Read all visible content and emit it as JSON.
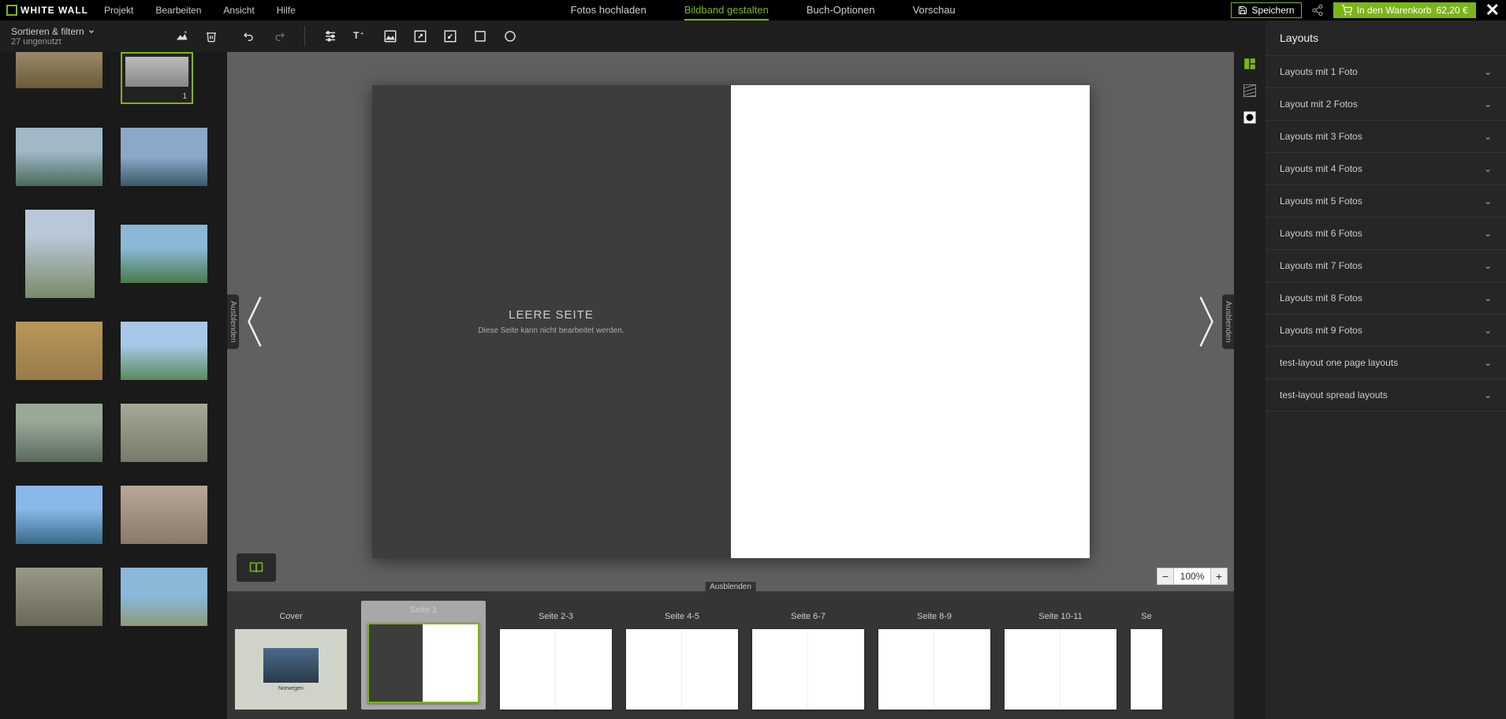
{
  "brand": "WHITE WALL",
  "top_menu": {
    "project": "Projekt",
    "edit": "Bearbeiten",
    "view": "Ansicht",
    "help": "Hilfe"
  },
  "nav": {
    "upload": "Fotos hochladen",
    "design": "Bildband gestalten",
    "options": "Buch-Optionen",
    "preview": "Vorschau"
  },
  "actions": {
    "save": "Speichern",
    "cart": "In den Warenkorb",
    "price": "62,20 €"
  },
  "sort": {
    "label": "Sortieren & filtern",
    "sub": "27 ungenutzt"
  },
  "page": {
    "title": "LEERE SEITE",
    "subtitle": "Diese Seite kann nicht bearbeitet werden."
  },
  "zoom": "100%",
  "hide_label": "Ausblenden",
  "tooltip": "Ausblenden",
  "selected_thumb_badge": "1",
  "filmstrip": [
    {
      "label": "Cover",
      "type": "cover",
      "cover_text": "Norwegen"
    },
    {
      "label": "Seite 1",
      "type": "selected"
    },
    {
      "label": "Seite 2-3",
      "type": "spread"
    },
    {
      "label": "Seite 4-5",
      "type": "spread"
    },
    {
      "label": "Seite 6-7",
      "type": "spread"
    },
    {
      "label": "Seite 8-9",
      "type": "spread"
    },
    {
      "label": "Seite 10-11",
      "type": "spread"
    },
    {
      "label": "Se",
      "type": "spread"
    }
  ],
  "right_panel": {
    "title": "Layouts",
    "items": [
      "Layouts mit 1 Foto",
      "Layout mit 2 Fotos",
      "Layouts mit 3 Fotos",
      "Layouts mit 4 Fotos",
      "Layouts mit 5 Fotos",
      "Layouts mit 6 Fotos",
      "Layouts mit 7 Fotos",
      "Layouts mit 8 Fotos",
      "Layouts mit 9 Fotos",
      "test-layout one page layouts",
      "test-layout spread layouts"
    ]
  }
}
